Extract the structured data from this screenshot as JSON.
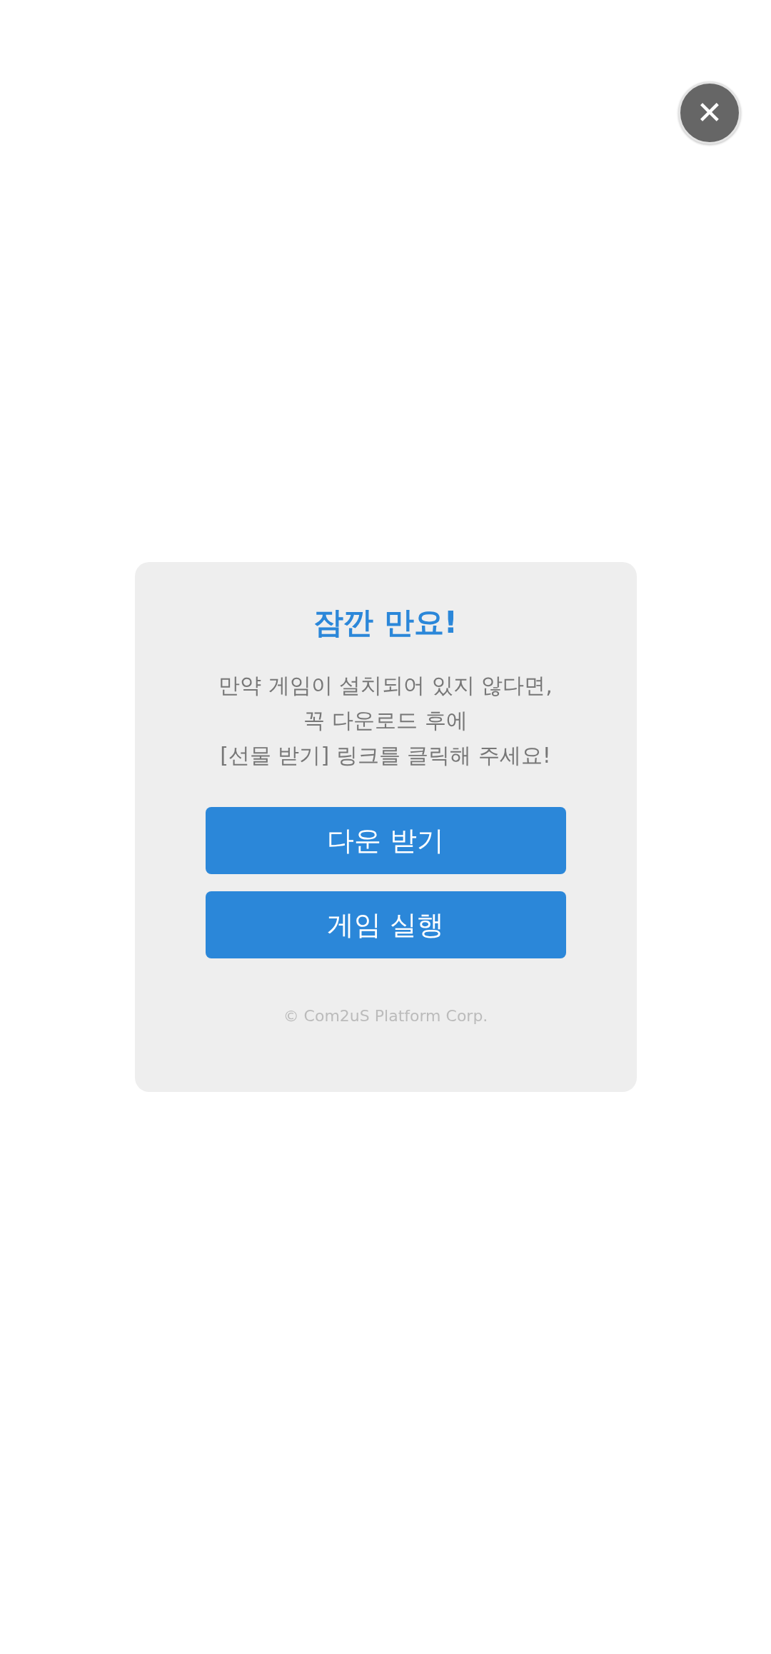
{
  "close_button": {
    "label": "✕"
  },
  "dialog": {
    "title": "잠깐 만요!",
    "message_lines": [
      "만약 게임이 설치되어 있지 않다면,",
      "꼭 다운로드 후에",
      "[선물 받기] 링크를 클릭해 주세요!"
    ],
    "buttons": [
      "다운 받기",
      "게임 실행"
    ],
    "footer": "© Com2uS Platform Corp."
  }
}
